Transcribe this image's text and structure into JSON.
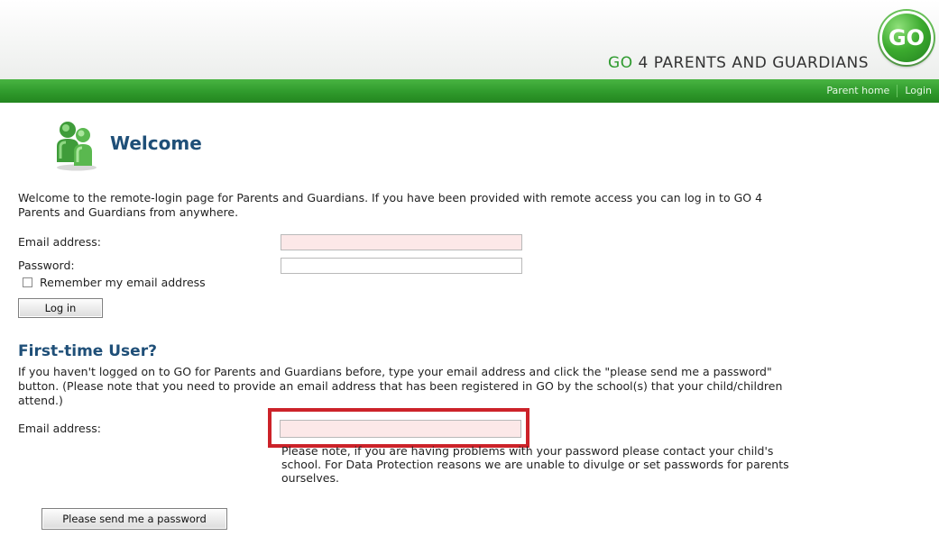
{
  "header": {
    "brand_go": "GO",
    "brand_rest": " 4 PARENTS AND GUARDIANS",
    "logo_text": "GO"
  },
  "nav": {
    "items": [
      "Parent home",
      "Login"
    ]
  },
  "welcome": {
    "title": "Welcome",
    "intro": "Welcome to the remote-login page for Parents and Guardians. If you have been provided with remote access you can log in to GO 4 Parents and Guardians from anywhere."
  },
  "login": {
    "email_label": "Email address:",
    "email_value": "",
    "password_label": "Password:",
    "password_value": "",
    "remember_label": "Remember my email address",
    "login_button": "Log in"
  },
  "first_time": {
    "title": "First-time User?",
    "text": "If you haven't logged on to GO for Parents and Guardians before, type your email address and click the \"please send me a password\" button. (Please note that you need to provide an email address that has been registered in GO by the school(s) that your child/children attend.)",
    "email_label": "Email address:",
    "email_value": "",
    "note": "Please note, if you are having problems with your password please contact your child's school. For Data Protection reasons we are unable to divulge or set passwords for parents ourselves.",
    "send_button": "Please send me a password"
  },
  "colors": {
    "brand_green": "#2e9a2e",
    "heading_blue": "#1f4f78",
    "highlight_red": "#cc2229",
    "required_field": "#fce8e8"
  }
}
